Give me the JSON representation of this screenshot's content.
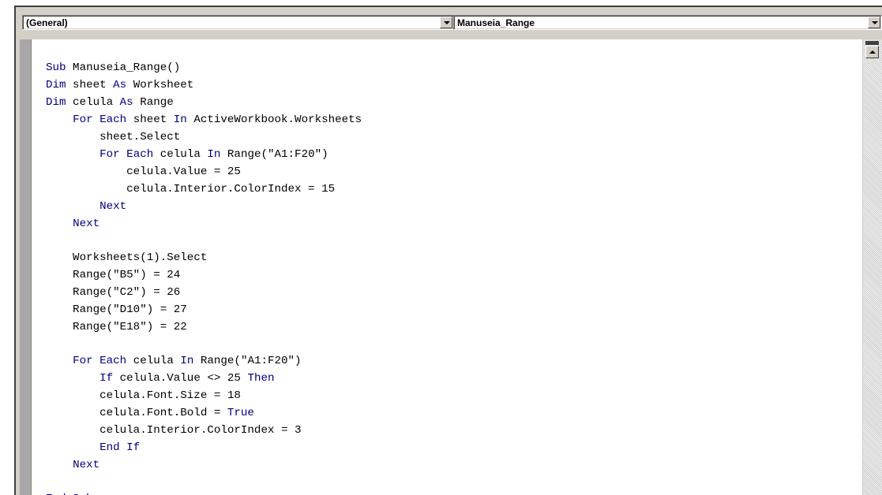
{
  "dropdowns": {
    "object": "(General)",
    "procedure": "Manuseia_Range"
  },
  "code": {
    "l1": [
      {
        "t": "Sub",
        "k": true
      },
      {
        "t": " Manuseia_Range()"
      }
    ],
    "l2": [
      {
        "t": "Dim",
        "k": true
      },
      {
        "t": " sheet "
      },
      {
        "t": "As",
        "k": true
      },
      {
        "t": " Worksheet"
      }
    ],
    "l3": [
      {
        "t": "Dim",
        "k": true
      },
      {
        "t": " celula "
      },
      {
        "t": "As",
        "k": true
      },
      {
        "t": " Range"
      }
    ],
    "l4": [
      {
        "t": "    "
      },
      {
        "t": "For Each",
        "k": true
      },
      {
        "t": " sheet "
      },
      {
        "t": "In",
        "k": true
      },
      {
        "t": " ActiveWorkbook.Worksheets"
      }
    ],
    "l5": [
      {
        "t": "        sheet.Select"
      }
    ],
    "l6": [
      {
        "t": "        "
      },
      {
        "t": "For Each",
        "k": true
      },
      {
        "t": " celula "
      },
      {
        "t": "In",
        "k": true
      },
      {
        "t": " Range(\"A1:F20\")"
      }
    ],
    "l7": [
      {
        "t": "            celula.Value = 25"
      }
    ],
    "l8": [
      {
        "t": "            celula.Interior.ColorIndex = 15"
      }
    ],
    "l9": [
      {
        "t": "        "
      },
      {
        "t": "Next",
        "k": true
      }
    ],
    "l10": [
      {
        "t": "    "
      },
      {
        "t": "Next",
        "k": true
      }
    ],
    "l11": [
      {
        "t": ""
      }
    ],
    "l12": [
      {
        "t": "    Worksheets(1).Select"
      }
    ],
    "l13": [
      {
        "t": "    Range(\"B5\") = 24"
      }
    ],
    "l14": [
      {
        "t": "    Range(\"C2\") = 26"
      }
    ],
    "l15": [
      {
        "t": "    Range(\"D10\") = 27"
      }
    ],
    "l16": [
      {
        "t": "    Range(\"E18\") = 22"
      }
    ],
    "l17": [
      {
        "t": ""
      }
    ],
    "l18": [
      {
        "t": "    "
      },
      {
        "t": "For Each",
        "k": true
      },
      {
        "t": " celula "
      },
      {
        "t": "In",
        "k": true
      },
      {
        "t": " Range(\"A1:F20\")"
      }
    ],
    "l19": [
      {
        "t": "        "
      },
      {
        "t": "If",
        "k": true
      },
      {
        "t": " celula.Value <> 25 "
      },
      {
        "t": "Then",
        "k": true
      }
    ],
    "l20": [
      {
        "t": "        celula.Font.Size = 18"
      }
    ],
    "l21": [
      {
        "t": "        celula.Font.Bold = "
      },
      {
        "t": "True",
        "k": true
      }
    ],
    "l22": [
      {
        "t": "        celula.Interior.ColorIndex = 3"
      }
    ],
    "l23": [
      {
        "t": "        "
      },
      {
        "t": "End If",
        "k": true
      }
    ],
    "l24": [
      {
        "t": "    "
      },
      {
        "t": "Next",
        "k": true
      }
    ],
    "l25": [
      {
        "t": ""
      }
    ],
    "l26": [
      {
        "t": "End Sub",
        "k": true
      }
    ]
  },
  "colors": {
    "keyword": "#000080",
    "text": "#000000",
    "chrome": "#d4d0c8"
  },
  "icons": [
    "chevron-down-icon",
    "scroll-up-arrow-icon"
  ]
}
